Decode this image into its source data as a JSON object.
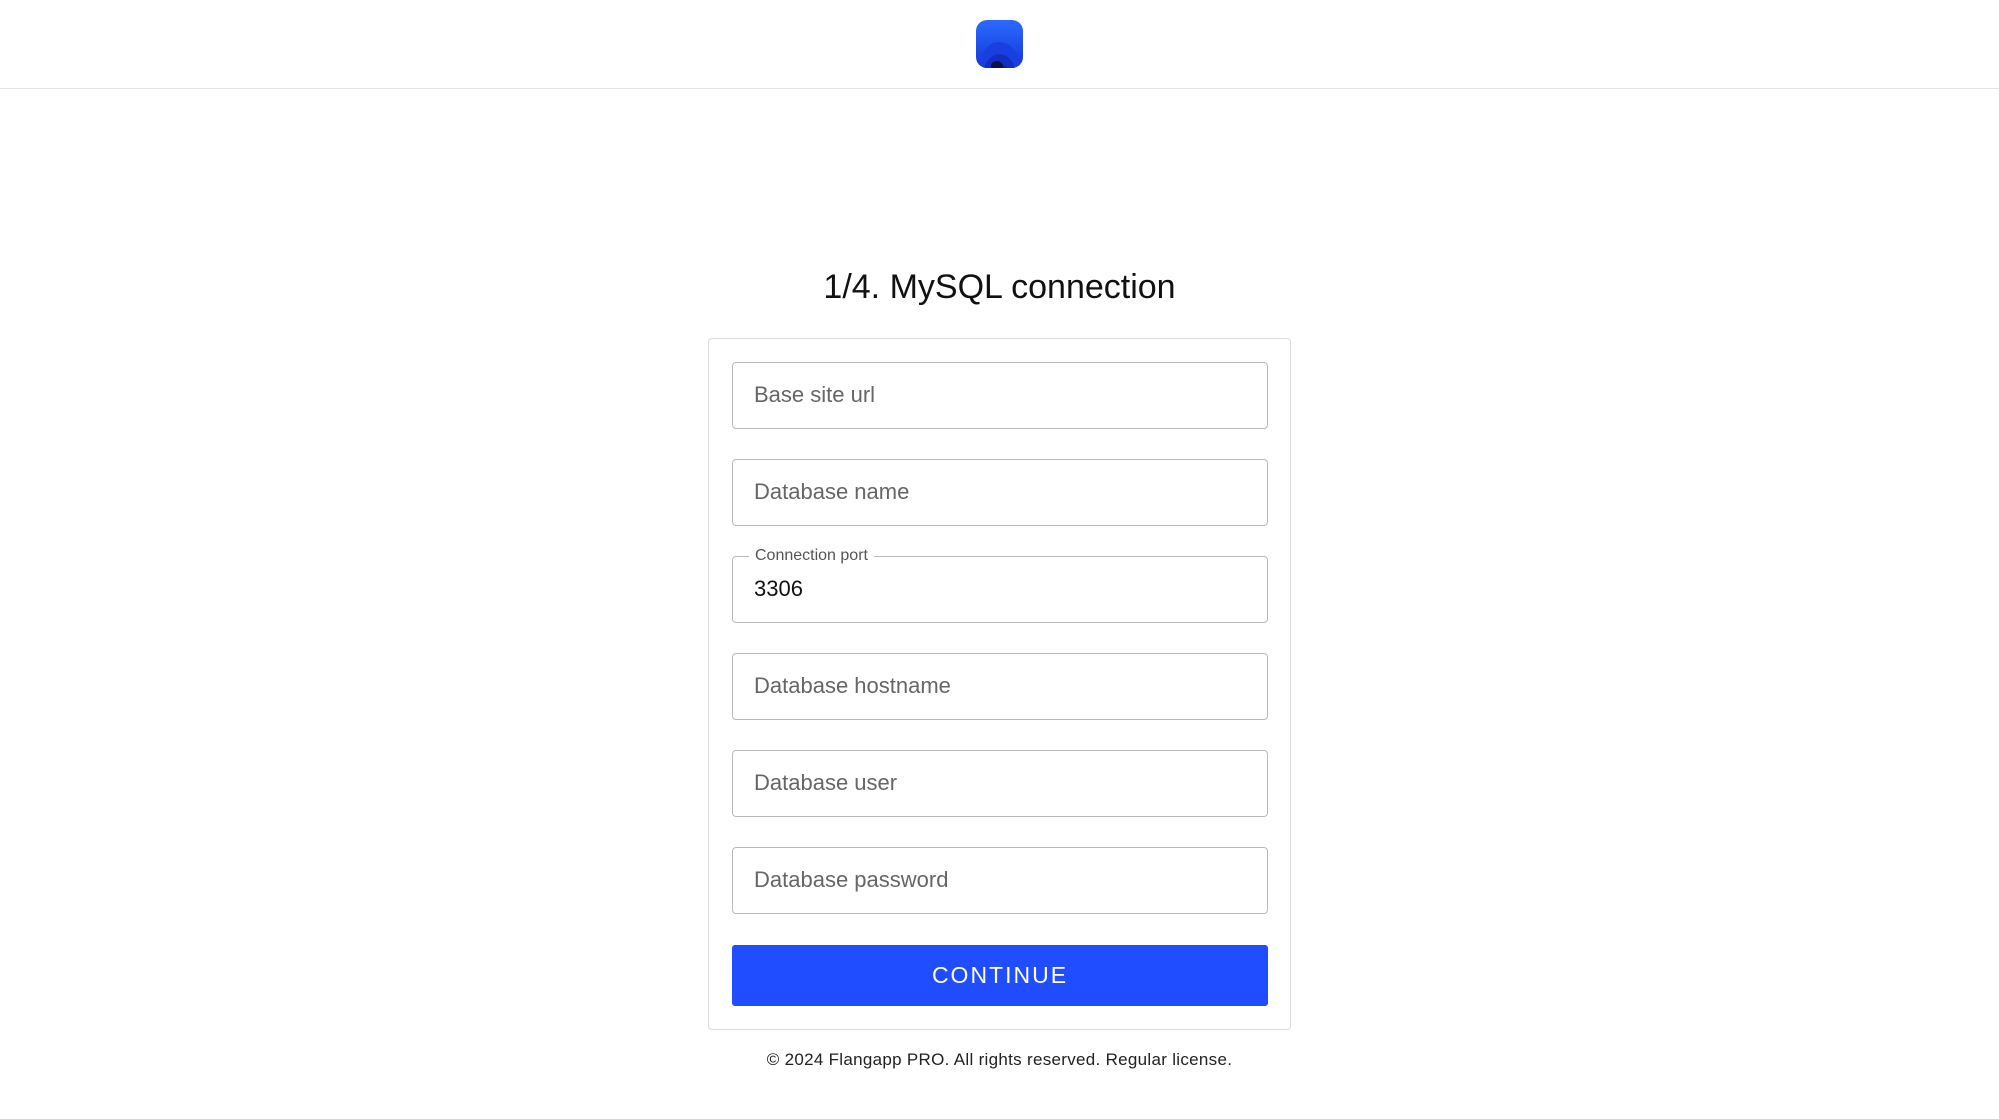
{
  "header": {
    "logo_icon": "app-logo-icon",
    "brand_color": "#1f4dff"
  },
  "page": {
    "title": "1/4. MySQL connection"
  },
  "form": {
    "base_site_url": {
      "placeholder": "Base site url",
      "value": ""
    },
    "database_name": {
      "placeholder": "Database name",
      "value": ""
    },
    "connection_port": {
      "label": "Connection port",
      "value": "3306"
    },
    "database_hostname": {
      "placeholder": "Database hostname",
      "value": ""
    },
    "database_user": {
      "placeholder": "Database user",
      "value": ""
    },
    "database_password": {
      "placeholder": "Database password",
      "value": ""
    },
    "continue_label": "CONTINUE"
  },
  "footer": {
    "text": "© 2024 Flangapp PRO. All rights reserved. Regular license."
  }
}
